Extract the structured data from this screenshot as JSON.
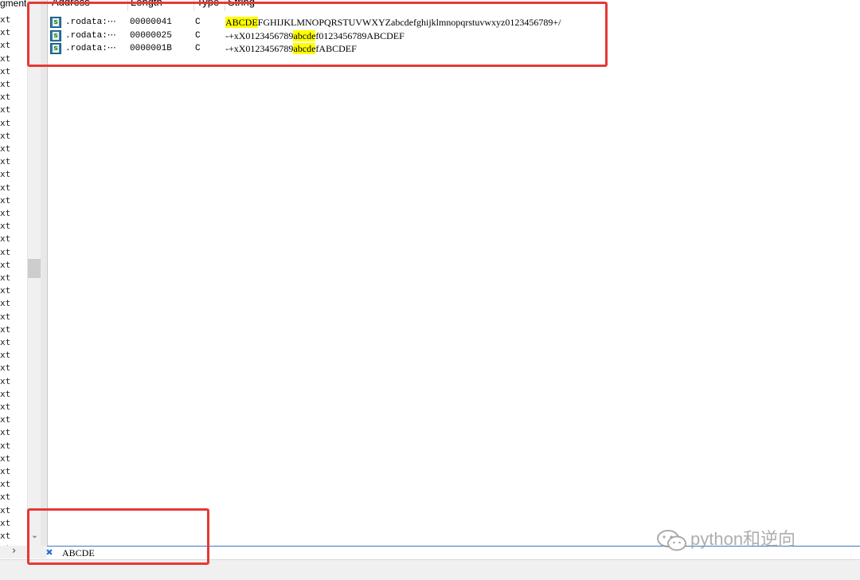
{
  "left_segment": {
    "header": "gment S",
    "row_label": "xt",
    "row_count": 42
  },
  "columns": {
    "address": "Address",
    "length": "Length",
    "type": "Type",
    "string": "String"
  },
  "strings": [
    {
      "address": ".rodata:⋯",
      "length": "00000041",
      "type": "C",
      "segments": [
        {
          "text": "ABCDE",
          "hl": true
        },
        {
          "text": "FGHIJKLMNOPQRSTUVWXYZabcdefghijklmnopqrstuvwxyz0123456789+/",
          "hl": false
        }
      ]
    },
    {
      "address": ".rodata:⋯",
      "length": "00000025",
      "type": "C",
      "segments": [
        {
          "text": "-+xX0123456789",
          "hl": false
        },
        {
          "text": "abcde",
          "hl": true
        },
        {
          "text": "f0123456789ABCDEF",
          "hl": false
        }
      ]
    },
    {
      "address": ".rodata:⋯",
      "length": "0000001B",
      "type": "C",
      "segments": [
        {
          "text": "-+xX0123456789",
          "hl": false
        },
        {
          "text": "abcde",
          "hl": true
        },
        {
          "text": "fABCDEF",
          "hl": false
        }
      ]
    }
  ],
  "filter": {
    "value": "ABCDE"
  },
  "icons": {
    "string_icon": "string-icon",
    "clear_filter": "close-icon"
  },
  "watermark": {
    "text": "python和逆向"
  },
  "colors": {
    "highlight": "#ffff00",
    "annotation": "#e53935",
    "filter_border": "#3a78c0"
  }
}
